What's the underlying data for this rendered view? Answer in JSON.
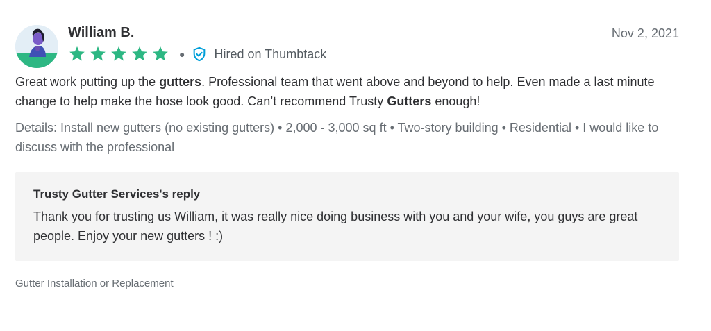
{
  "review": {
    "reviewer_name": "William B.",
    "date": "Nov 2, 2021",
    "rating": 5,
    "rating_max": 5,
    "hired_label": "Hired on Thumbtack",
    "verified_icon": "shield-check-icon",
    "star_color": "#2db783",
    "accent_color": "#009fd9",
    "text_parts": [
      {
        "text": "Great work putting up the ",
        "bold": false
      },
      {
        "text": "gutters",
        "bold": true
      },
      {
        "text": ". Professional team that went above and beyond to help. Even made a last minute change to help make the hose look good. Can’t recommend Trusty ",
        "bold": false
      },
      {
        "text": "Gutters",
        "bold": true
      },
      {
        "text": " enough!",
        "bold": false
      }
    ],
    "details": "Details: Install new gutters (no existing gutters) • 2,000 - 3,000 sq ft • Two-story building • Residential • I would like to discuss with the professional"
  },
  "reply": {
    "title": "Trusty Gutter Services's reply",
    "text": "Thank you for trusting us William, it was really nice doing business with you and your wife, you guys are great people. Enjoy your new gutters ! :)"
  },
  "service_category": "Gutter Installation or Replacement"
}
